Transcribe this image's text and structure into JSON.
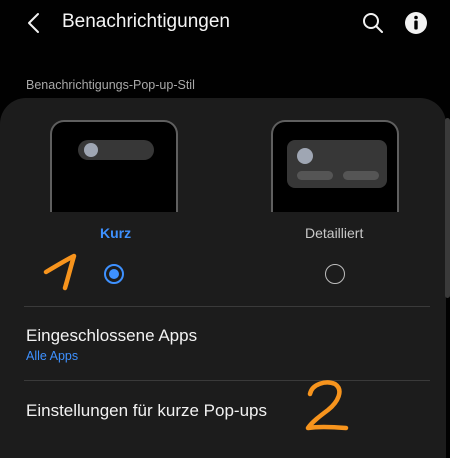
{
  "header": {
    "title": "Benachrichtigungen",
    "back_icon": "chevron-left-icon",
    "search_icon": "search-icon",
    "info_icon": "info-icon"
  },
  "section": {
    "label": "Benachrichtigungs-Pop-up-Stil"
  },
  "style_options": [
    {
      "label": "Kurz",
      "selected": true
    },
    {
      "label": "Detailliert",
      "selected": false
    }
  ],
  "settings": {
    "included_apps": {
      "title": "Eingeschlossene Apps",
      "value": "Alle Apps"
    },
    "short_popups": {
      "title": "Einstellungen für kurze Pop-ups"
    }
  },
  "annotations": [
    "1",
    "2"
  ],
  "colors": {
    "accent": "#3e91ff",
    "annotation": "#f7941d",
    "background": "#010101",
    "card": "#1c1c1c"
  }
}
